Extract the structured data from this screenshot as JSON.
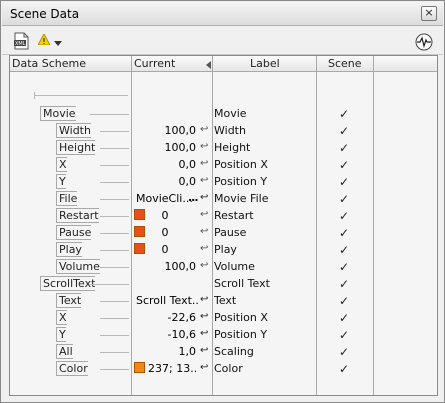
{
  "window": {
    "title": "Scene Data",
    "close_glyph": "×"
  },
  "toolbar": {
    "xml_icon": "xml-file-icon",
    "warning_icon": "warning-icon",
    "dropdown_icon": "chevron-down-icon",
    "monitor_icon": "waveform-icon"
  },
  "columns": {
    "data_scheme": "Data Scheme",
    "current": "Current",
    "label": "Label",
    "scene": "Scene"
  },
  "check_glyph": "✓",
  "link_glyph": "↩",
  "rows": [
    {
      "name": "",
      "current": "",
      "label": "",
      "scene": "",
      "indent": 0
    },
    {
      "name": "Movie",
      "current": "",
      "label": "Movie",
      "scene": "✓",
      "indent": 1
    },
    {
      "name": "Width",
      "current": "100,0",
      "label": "Width",
      "scene": "✓",
      "indent": 2,
      "link": true
    },
    {
      "name": "Height",
      "current": "100,0",
      "label": "Height",
      "scene": "✓",
      "indent": 2,
      "link": true
    },
    {
      "name": "X",
      "current": "0,0",
      "label": "Position X",
      "scene": "✓",
      "indent": 2,
      "link": true
    },
    {
      "name": "Y",
      "current": "0,0",
      "label": "Position Y",
      "scene": "✓",
      "indent": 2,
      "link": true
    },
    {
      "name": "File",
      "current": "MovieCli...",
      "label": "Movie File",
      "scene": "✓",
      "indent": 2,
      "link": true,
      "dots": "..."
    },
    {
      "name": "Restart",
      "current": "0",
      "label": "Restart",
      "scene": "✓",
      "indent": 2,
      "link": true,
      "swatch": "#e8501a"
    },
    {
      "name": "Pause",
      "current": "0",
      "label": "Pause",
      "scene": "✓",
      "indent": 2,
      "link": true,
      "swatch": "#e8501a"
    },
    {
      "name": "Play",
      "current": "0",
      "label": "Play",
      "scene": "✓",
      "indent": 2,
      "link": true,
      "swatch": "#e8501a"
    },
    {
      "name": "Volume",
      "current": "100,0",
      "label": "Volume",
      "scene": "✓",
      "indent": 2,
      "link": true
    },
    {
      "name": "ScrollText",
      "current": "",
      "label": "Scroll Text",
      "scene": "✓",
      "indent": 1
    },
    {
      "name": "Text",
      "current": "Scroll Text...",
      "label": "Text",
      "scene": "✓",
      "indent": 2,
      "link": true
    },
    {
      "name": "X",
      "current": "-22,6",
      "label": "Position X",
      "scene": "✓",
      "indent": 2,
      "link": true
    },
    {
      "name": "Y",
      "current": "-10,6",
      "label": "Position Y",
      "scene": "✓",
      "indent": 2,
      "link": true
    },
    {
      "name": "All",
      "current": "1,0",
      "label": "Scaling",
      "scene": "✓",
      "indent": 2,
      "link": true
    },
    {
      "name": "Color",
      "current": "237; 13...",
      "label": "Color",
      "scene": "✓",
      "indent": 2,
      "link": true,
      "swatch": "#ed8a10"
    }
  ]
}
